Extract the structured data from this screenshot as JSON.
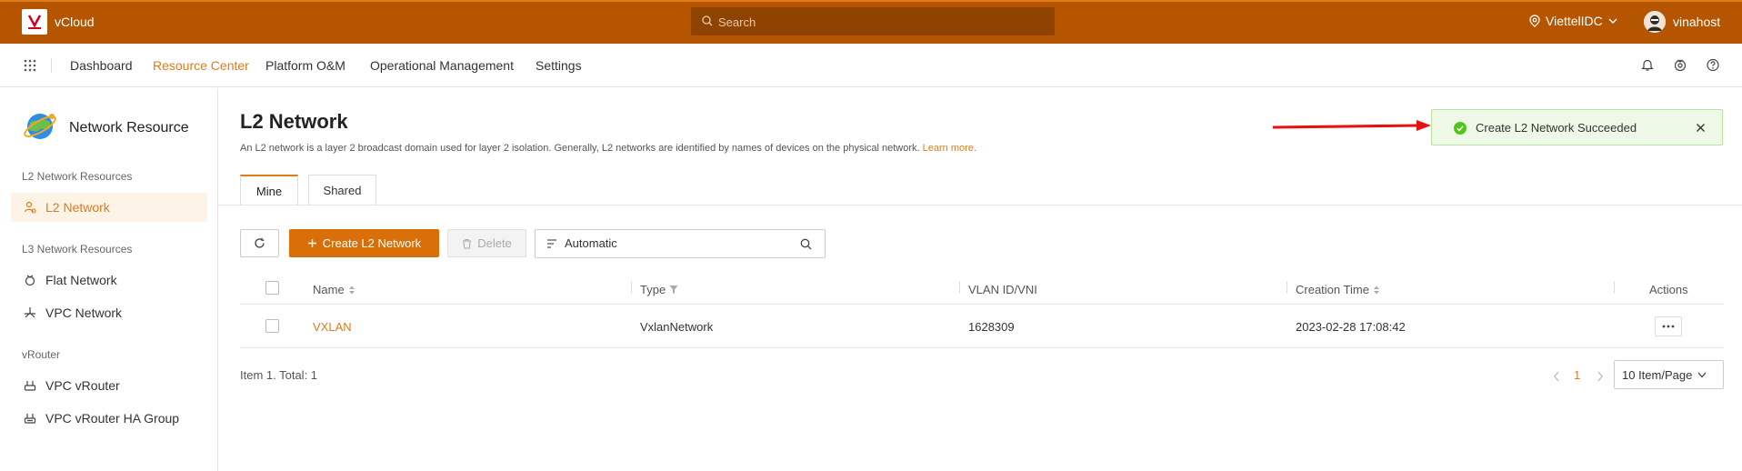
{
  "topbar": {
    "brand": "vCloud",
    "search_placeholder": "Search",
    "region": "ViettelIDC",
    "username": "vinahost"
  },
  "nav": {
    "items": [
      "Dashboard",
      "Resource Center",
      "Platform O&M",
      "Operational Management",
      "Settings"
    ],
    "active": "Resource Center"
  },
  "sidebar": {
    "title": "Network Resource",
    "groups": {
      "l2": "L2 Network Resources",
      "l3": "L3 Network Resources",
      "vrouter": "vRouter"
    },
    "items": {
      "l2_network": "L2 Network",
      "flat_network": "Flat Network",
      "vpc_network": "VPC Network",
      "vpc_vrouter": "VPC vRouter",
      "vpc_vrouter_ha": "VPC vRouter HA Group"
    }
  },
  "page": {
    "title": "L2 Network",
    "description": "An L2 network is a layer 2 broadcast domain used for layer 2 isolation. Generally, L2 networks are identified by names of devices on the physical network.",
    "learn_more": "Learn more.",
    "tabs": [
      "Mine",
      "Shared"
    ]
  },
  "toolbar": {
    "create_label": "Create L2 Network",
    "delete_label": "Delete",
    "filter_value": "Automatic"
  },
  "table": {
    "columns": {
      "name": "Name",
      "type": "Type",
      "vlan": "VLAN ID/VNI",
      "created": "Creation Time",
      "actions": "Actions"
    },
    "rows": [
      {
        "name": "VXLAN",
        "type": "VxlanNetwork",
        "vlan": "1628309",
        "created": "2023-02-28 17:08:42"
      }
    ]
  },
  "footer": {
    "total": "Item 1. Total: 1",
    "current_page": "1",
    "page_size": "10 Item/Page"
  },
  "toast": {
    "message": "Create L2 Network Succeeded"
  },
  "colors": {
    "topbar": "#b55500",
    "accent": "#e07b1a",
    "success": "#52c41a",
    "annotation_arrow": "#e81010"
  }
}
